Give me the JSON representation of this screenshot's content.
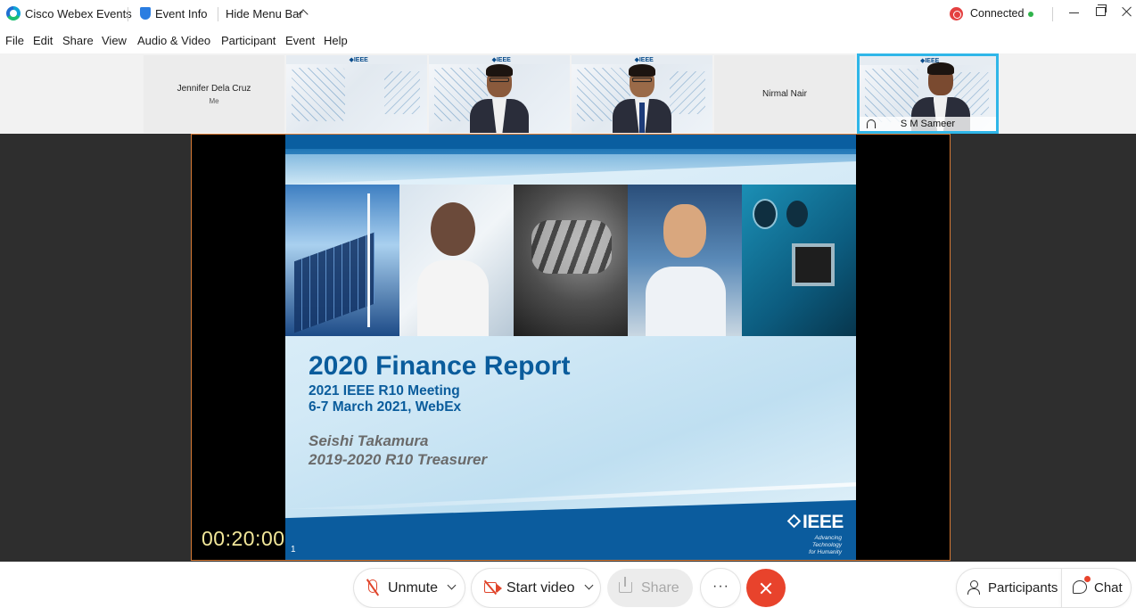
{
  "titlebar": {
    "app_name": "Cisco Webex Events",
    "event_info": "Event Info",
    "hide_menu": "Hide Menu Bar",
    "status": "Connected"
  },
  "menu": [
    "File",
    "Edit",
    "Share",
    "View",
    "Audio & Video",
    "Participant",
    "Event",
    "Help"
  ],
  "participants_strip": [
    {
      "name": "Jennifer Dela Cruz",
      "sub": "Me",
      "has_video": false
    },
    {
      "name": "",
      "has_video": true,
      "person": false
    },
    {
      "name": "",
      "has_video": true,
      "person": true
    },
    {
      "name": "",
      "has_video": true,
      "person": true
    },
    {
      "name": "Nirmal Nair",
      "has_video": false
    },
    {
      "name": "S M Sameer",
      "has_video": true,
      "person": true,
      "active_speaker": true
    }
  ],
  "stage": {
    "timer": "00:20:00",
    "page_number": "1"
  },
  "slide": {
    "title": "2020 Finance Report",
    "subtitle_1": "2021 IEEE R10 Meeting",
    "subtitle_2": "6-7 March 2021, WebEx",
    "author": "Seishi Takamura",
    "role": "2019-2020 R10 Treasurer",
    "logo_text": "IEEE",
    "logo_tagline_1": "Advancing Technology",
    "logo_tagline_2": "for Humanity"
  },
  "controls": {
    "unmute": "Unmute",
    "start_video": "Start video",
    "share": "Share",
    "more": "···",
    "participants": "Participants",
    "chat": "Chat"
  },
  "colors": {
    "accent_active": "#2fb6e8",
    "leave_red": "#e8432c",
    "slide_blue": "#0a5c9c",
    "timer_yellow": "#f2e79a"
  }
}
